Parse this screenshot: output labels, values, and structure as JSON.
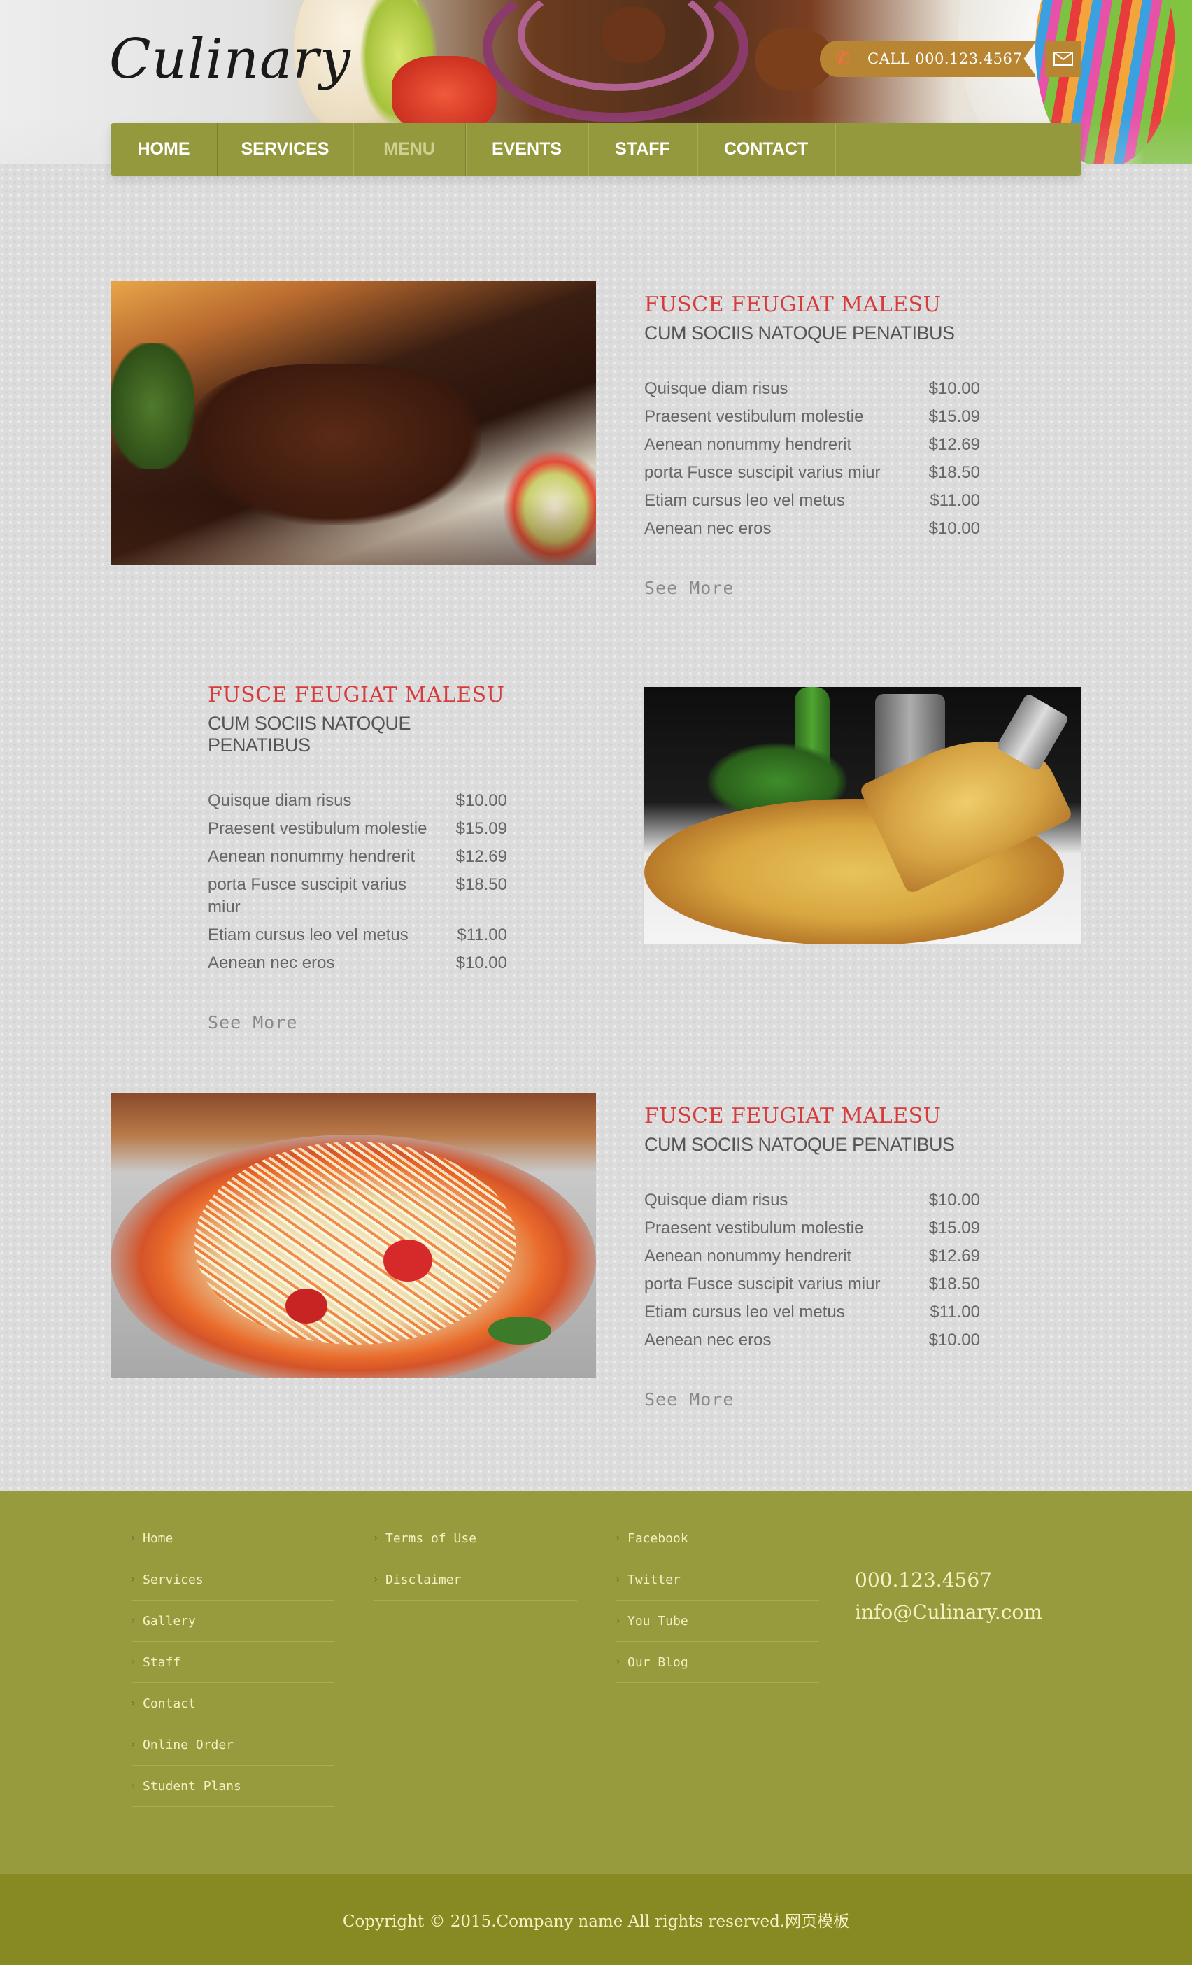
{
  "header": {
    "logo": "Culinary",
    "call_label": "CALL  000.123.4567"
  },
  "nav": {
    "items": [
      {
        "label": "HOME",
        "active": false
      },
      {
        "label": "SERVICES",
        "active": false
      },
      {
        "label": "MENU",
        "active": true
      },
      {
        "label": "EVENTS",
        "active": false
      },
      {
        "label": "STAFF",
        "active": false
      },
      {
        "label": "CONTACT",
        "active": false
      }
    ]
  },
  "sections": [
    {
      "title": "FUSCE FEUGIAT MALESU",
      "subtitle": "CUM SOCIIS NATOQUE PENATIBUS",
      "items": [
        {
          "name": "Quisque diam risus",
          "price": "$10.00"
        },
        {
          "name": "Praesent vestibulum molestie",
          "price": "$15.09"
        },
        {
          "name": "Aenean nonummy hendrerit",
          "price": "$12.69"
        },
        {
          "name": "porta Fusce suscipit varius miur",
          "price": "$18.50"
        },
        {
          "name": "Etiam cursus leo vel metus",
          "price": "$11.00"
        },
        {
          "name": "Aenean nec eros",
          "price": "$10.00"
        }
      ],
      "see_more": "See More"
    },
    {
      "title": "FUSCE FEUGIAT MALESU",
      "subtitle": "CUM SOCIIS NATOQUE PENATIBUS",
      "items": [
        {
          "name": "Quisque diam risus",
          "price": "$10.00"
        },
        {
          "name": "Praesent vestibulum molestie",
          "price": "$15.09"
        },
        {
          "name": "Aenean nonummy hendrerit",
          "price": "$12.69"
        },
        {
          "name": "porta Fusce suscipit varius miur",
          "price": "$18.50"
        },
        {
          "name": "Etiam cursus leo vel metus",
          "price": "$11.00"
        },
        {
          "name": "Aenean nec eros",
          "price": "$10.00"
        }
      ],
      "see_more": "See More"
    },
    {
      "title": "FUSCE FEUGIAT MALESU",
      "subtitle": "CUM SOCIIS NATOQUE PENATIBUS",
      "items": [
        {
          "name": "Quisque diam risus",
          "price": "$10.00"
        },
        {
          "name": "Praesent vestibulum molestie",
          "price": "$15.09"
        },
        {
          "name": "Aenean nonummy hendrerit",
          "price": "$12.69"
        },
        {
          "name": "porta Fusce suscipit varius miur",
          "price": "$18.50"
        },
        {
          "name": "Etiam cursus leo vel metus",
          "price": "$11.00"
        },
        {
          "name": "Aenean nec eros",
          "price": "$10.00"
        }
      ],
      "see_more": "See More"
    }
  ],
  "footer": {
    "col1": [
      "Home",
      "Services",
      "Gallery",
      "Staff",
      "Contact",
      "Online Order",
      "Student Plans"
    ],
    "col2": [
      "Terms of Use",
      "Disclaimer"
    ],
    "col3": [
      "Facebook",
      "Twitter",
      "You Tube",
      "Our Blog"
    ],
    "phone": "000.123.4567",
    "email": "info@Culinary.com",
    "copyright": "Copyright © 2015.Company name All rights reserved.网页模板"
  },
  "colors": {
    "nav_bg": "#95993d",
    "accent_red": "#d63c3c",
    "footer_bg": "#989b3d",
    "copyright_bg": "#878a22",
    "call_badge": "#b88633"
  }
}
